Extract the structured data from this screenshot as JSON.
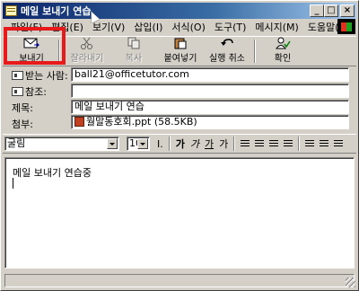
{
  "window": {
    "title": "메일 보내기 연습"
  },
  "menu": [
    "파일(F)",
    "편집(E)",
    "보기(V)",
    "삽입(I)",
    "서식(O)",
    "도구(T)",
    "메시지(M)",
    "도움말(H)"
  ],
  "toolbar": {
    "send": "보내기",
    "cut": "잘라내기",
    "copy": "복사",
    "paste": "붙여넣기",
    "undo": "실행 취소",
    "check": "확인"
  },
  "header": {
    "to_label": "받는 사람:",
    "to_value": "ball21@officetutor.com",
    "cc_label": "참조:",
    "cc_value": "",
    "subject_label": "제목:",
    "subject_value": "메일 보내기 연습",
    "attach_label": "첨부:",
    "attach_value": "월말동호회.ppt (58.5KB)"
  },
  "format": {
    "font": "굴림",
    "size": "10",
    "bold": "가",
    "italic": "가",
    "underline": "가",
    "color": "가"
  },
  "body": {
    "text": "메일 보내기 연습중"
  },
  "colors": {
    "highlight": "#e8191b",
    "title_bar": "#0a246a"
  }
}
